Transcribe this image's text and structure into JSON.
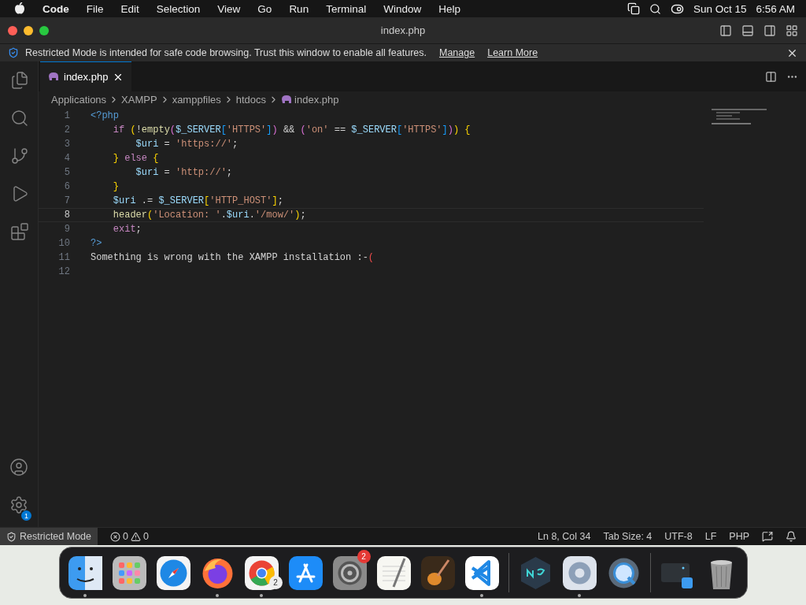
{
  "menu_bar": {
    "app": "Code",
    "menus": [
      "File",
      "Edit",
      "Selection",
      "View",
      "Go",
      "Run",
      "Terminal",
      "Window",
      "Help"
    ],
    "date": "Sun Oct 15",
    "time": "6:56 AM"
  },
  "window": {
    "title": "index.php"
  },
  "banner": {
    "message": "Restricted Mode is intended for safe code browsing. Trust this window to enable all features.",
    "links": [
      "Manage",
      "Learn More"
    ]
  },
  "activity_bar": {
    "items": [
      {
        "kind": "files",
        "selected": false
      },
      {
        "kind": "search",
        "selected": false
      },
      {
        "kind": "source-control",
        "selected": false
      },
      {
        "kind": "run",
        "selected": false
      },
      {
        "kind": "extensions",
        "selected": false
      }
    ],
    "settings_badge": "1"
  },
  "tabs": [
    {
      "label": "index.php",
      "selected": true
    }
  ],
  "breadcrumb": [
    "Applications",
    "XAMPP",
    "xamppfiles",
    "htdocs",
    "index.php"
  ],
  "code": [
    {
      "number": "1",
      "current": false,
      "tokens": [
        {
          "text": "<?php",
          "kind": "tag"
        }
      ]
    },
    {
      "number": "2",
      "current": false,
      "tokens": [
        {
          "text": "    if",
          "kind": "keyword"
        },
        {
          "text": " (",
          "kind": "bracket1"
        },
        {
          "text": "!",
          "kind": "plain"
        },
        {
          "text": "empty",
          "kind": "function"
        },
        {
          "text": "(",
          "kind": "bracket2"
        },
        {
          "text": "$_SERVER",
          "kind": "variable"
        },
        {
          "text": "[",
          "kind": "bracket3"
        },
        {
          "text": "'HTTPS'",
          "kind": "string"
        },
        {
          "text": "]",
          "kind": "bracket3"
        },
        {
          "text": ")",
          "kind": "bracket2"
        },
        {
          "text": " && ",
          "kind": "plain"
        },
        {
          "text": "(",
          "kind": "bracket2"
        },
        {
          "text": "'on'",
          "kind": "string"
        },
        {
          "text": " == ",
          "kind": "plain"
        },
        {
          "text": "$_SERVER",
          "kind": "variable"
        },
        {
          "text": "[",
          "kind": "bracket3"
        },
        {
          "text": "'HTTPS'",
          "kind": "string"
        },
        {
          "text": "]",
          "kind": "bracket3"
        },
        {
          "text": ")",
          "kind": "bracket2"
        },
        {
          "text": ")",
          "kind": "bracket1"
        },
        {
          "text": " {",
          "kind": "bracket1"
        }
      ]
    },
    {
      "number": "3",
      "current": false,
      "tokens": [
        {
          "text": "        $uri",
          "kind": "variable"
        },
        {
          "text": " = ",
          "kind": "plain"
        },
        {
          "text": "'https://'",
          "kind": "string"
        },
        {
          "text": ";",
          "kind": "plain"
        }
      ]
    },
    {
      "number": "4",
      "current": false,
      "tokens": [
        {
          "text": "    }",
          "kind": "bracket1"
        },
        {
          "text": " else",
          "kind": "keyword"
        },
        {
          "text": " {",
          "kind": "bracket1"
        }
      ]
    },
    {
      "number": "5",
      "current": false,
      "tokens": [
        {
          "text": "        $uri",
          "kind": "variable"
        },
        {
          "text": " = ",
          "kind": "plain"
        },
        {
          "text": "'http://'",
          "kind": "string"
        },
        {
          "text": ";",
          "kind": "plain"
        }
      ]
    },
    {
      "number": "6",
      "current": false,
      "tokens": [
        {
          "text": "    }",
          "kind": "bracket1"
        }
      ]
    },
    {
      "number": "7",
      "current": false,
      "tokens": [
        {
          "text": "    $uri",
          "kind": "variable"
        },
        {
          "text": " .= ",
          "kind": "plain"
        },
        {
          "text": "$_SERVER",
          "kind": "variable"
        },
        {
          "text": "[",
          "kind": "bracket1"
        },
        {
          "text": "'HTTP_HOST'",
          "kind": "string"
        },
        {
          "text": "]",
          "kind": "bracket1"
        },
        {
          "text": ";",
          "kind": "plain"
        }
      ]
    },
    {
      "number": "8",
      "current": true,
      "tokens": [
        {
          "text": "    header",
          "kind": "function"
        },
        {
          "text": "(",
          "kind": "bracket1"
        },
        {
          "text": "'Location: '",
          "kind": "string"
        },
        {
          "text": ".",
          "kind": "plain"
        },
        {
          "text": "$uri",
          "kind": "variable"
        },
        {
          "text": ".",
          "kind": "plain"
        },
        {
          "text": "'/mow/'",
          "kind": "string"
        },
        {
          "text": ")",
          "kind": "bracket1"
        },
        {
          "text": ";",
          "kind": "plain"
        }
      ]
    },
    {
      "number": "9",
      "current": false,
      "tokens": [
        {
          "text": "    exit",
          "kind": "keyword"
        },
        {
          "text": ";",
          "kind": "plain"
        }
      ]
    },
    {
      "number": "10",
      "current": false,
      "tokens": [
        {
          "text": "?>",
          "kind": "tag"
        }
      ]
    },
    {
      "number": "11",
      "current": false,
      "tokens": [
        {
          "text": "Something is wrong with the XAMPP installation :-",
          "kind": "plain"
        },
        {
          "text": "(",
          "kind": "error"
        }
      ]
    },
    {
      "number": "12",
      "current": false
    }
  ],
  "status_bar": {
    "mode": "Restricted Mode",
    "errors": "0",
    "warnings": "0",
    "position": "Ln 8, Col 34",
    "tab_size": "Tab Size: 4",
    "encoding": "UTF-8",
    "eol": "LF",
    "language": "PHP"
  },
  "dock": [
    {
      "kind": "finder",
      "running": true
    },
    {
      "kind": "launchpad",
      "running": false
    },
    {
      "kind": "safari",
      "running": false
    },
    {
      "kind": "firefox",
      "running": true
    },
    {
      "kind": "chrome",
      "running": true,
      "badge": {
        "text": "2",
        "kind": "count"
      }
    },
    {
      "kind": "app-store",
      "running": false
    },
    {
      "kind": "settings",
      "running": false,
      "badge": {
        "text": "2",
        "kind": "alert"
      }
    },
    {
      "kind": "textedit",
      "running": false
    },
    {
      "kind": "garageband",
      "running": false
    },
    {
      "kind": "vscode",
      "running": true
    },
    {
      "kind": "separator"
    },
    {
      "kind": "nox",
      "running": false
    },
    {
      "kind": "preferences",
      "running": true
    },
    {
      "kind": "quicktime",
      "running": false
    },
    {
      "kind": "separator"
    },
    {
      "kind": "folder",
      "running": false
    },
    {
      "kind": "trash",
      "running": false
    }
  ]
}
